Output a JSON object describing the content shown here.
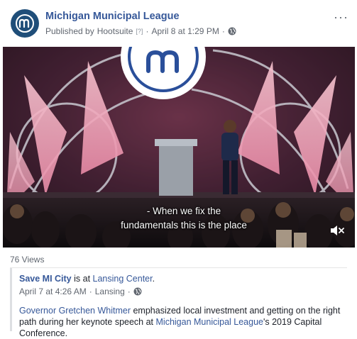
{
  "post": {
    "page_name": "Michigan Municipal League",
    "published_by_prefix": "Published by",
    "publisher": "Hootsuite",
    "publisher_help": "[?]",
    "separator": "·",
    "date": "April 8 at 1:29 PM",
    "more_label": "···"
  },
  "video": {
    "subtitle_line1": "- When we fix the",
    "subtitle_line2": "fundamentals this is the place",
    "muted": true
  },
  "stats": {
    "views": "76 Views"
  },
  "shared": {
    "author": "Save MI City",
    "is_at": " is at ",
    "location": "Lansing Center",
    "period": ".",
    "date": "April 7 at 4:26 AM",
    "sep": "·",
    "city": "Lansing",
    "text_link1": "Governor Gretchen Whitmer",
    "text_part1": " emphasized local investment and getting on the right path during her keynote speech at ",
    "text_link2": "Michigan Municipal League",
    "text_part2": "'s 2019 Capital Conference."
  },
  "colors": {
    "link": "#365899",
    "meta": "#616770",
    "avatar": "#1f4e79"
  }
}
